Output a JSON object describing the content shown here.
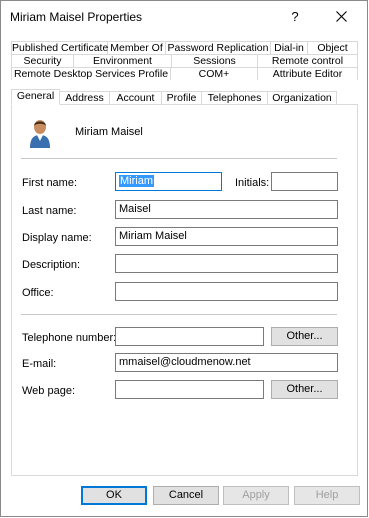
{
  "window": {
    "title": "Miriam Maisel Properties",
    "help_label": "?"
  },
  "tabs": {
    "row1": [
      "Published Certificates",
      "Member Of",
      "Password Replication",
      "Dial-in",
      "Object"
    ],
    "row2": [
      "Security",
      "Environment",
      "Sessions",
      "Remote control"
    ],
    "row3": [
      "Remote Desktop Services Profile",
      "COM+",
      "Attribute Editor"
    ],
    "row4": [
      "General",
      "Address",
      "Account",
      "Profile",
      "Telephones",
      "Organization"
    ],
    "selected": "General"
  },
  "general": {
    "user_display": "Miriam Maisel",
    "fields": {
      "first_name": {
        "label": "First name:",
        "value": "Miriam"
      },
      "initials": {
        "label": "Initials:",
        "value": ""
      },
      "last_name": {
        "label": "Last name:",
        "value": "Maisel"
      },
      "display_name": {
        "label": "Display name:",
        "value": "Miriam Maisel"
      },
      "description": {
        "label": "Description:",
        "value": ""
      },
      "office": {
        "label": "Office:",
        "value": ""
      },
      "telephone": {
        "label": "Telephone number:",
        "value": ""
      },
      "email": {
        "label": "E-mail:",
        "value": "mmaisel@cloudmenow.net"
      },
      "web_page": {
        "label": "Web page:",
        "value": ""
      }
    },
    "other_label": "Other..."
  },
  "buttons": {
    "ok": "OK",
    "cancel": "Cancel",
    "apply": "Apply",
    "help": "Help"
  },
  "icons": {
    "user": "user-icon",
    "close": "close-icon"
  },
  "colors": {
    "selection": "#3399ff",
    "focus_border": "#0078d7"
  }
}
